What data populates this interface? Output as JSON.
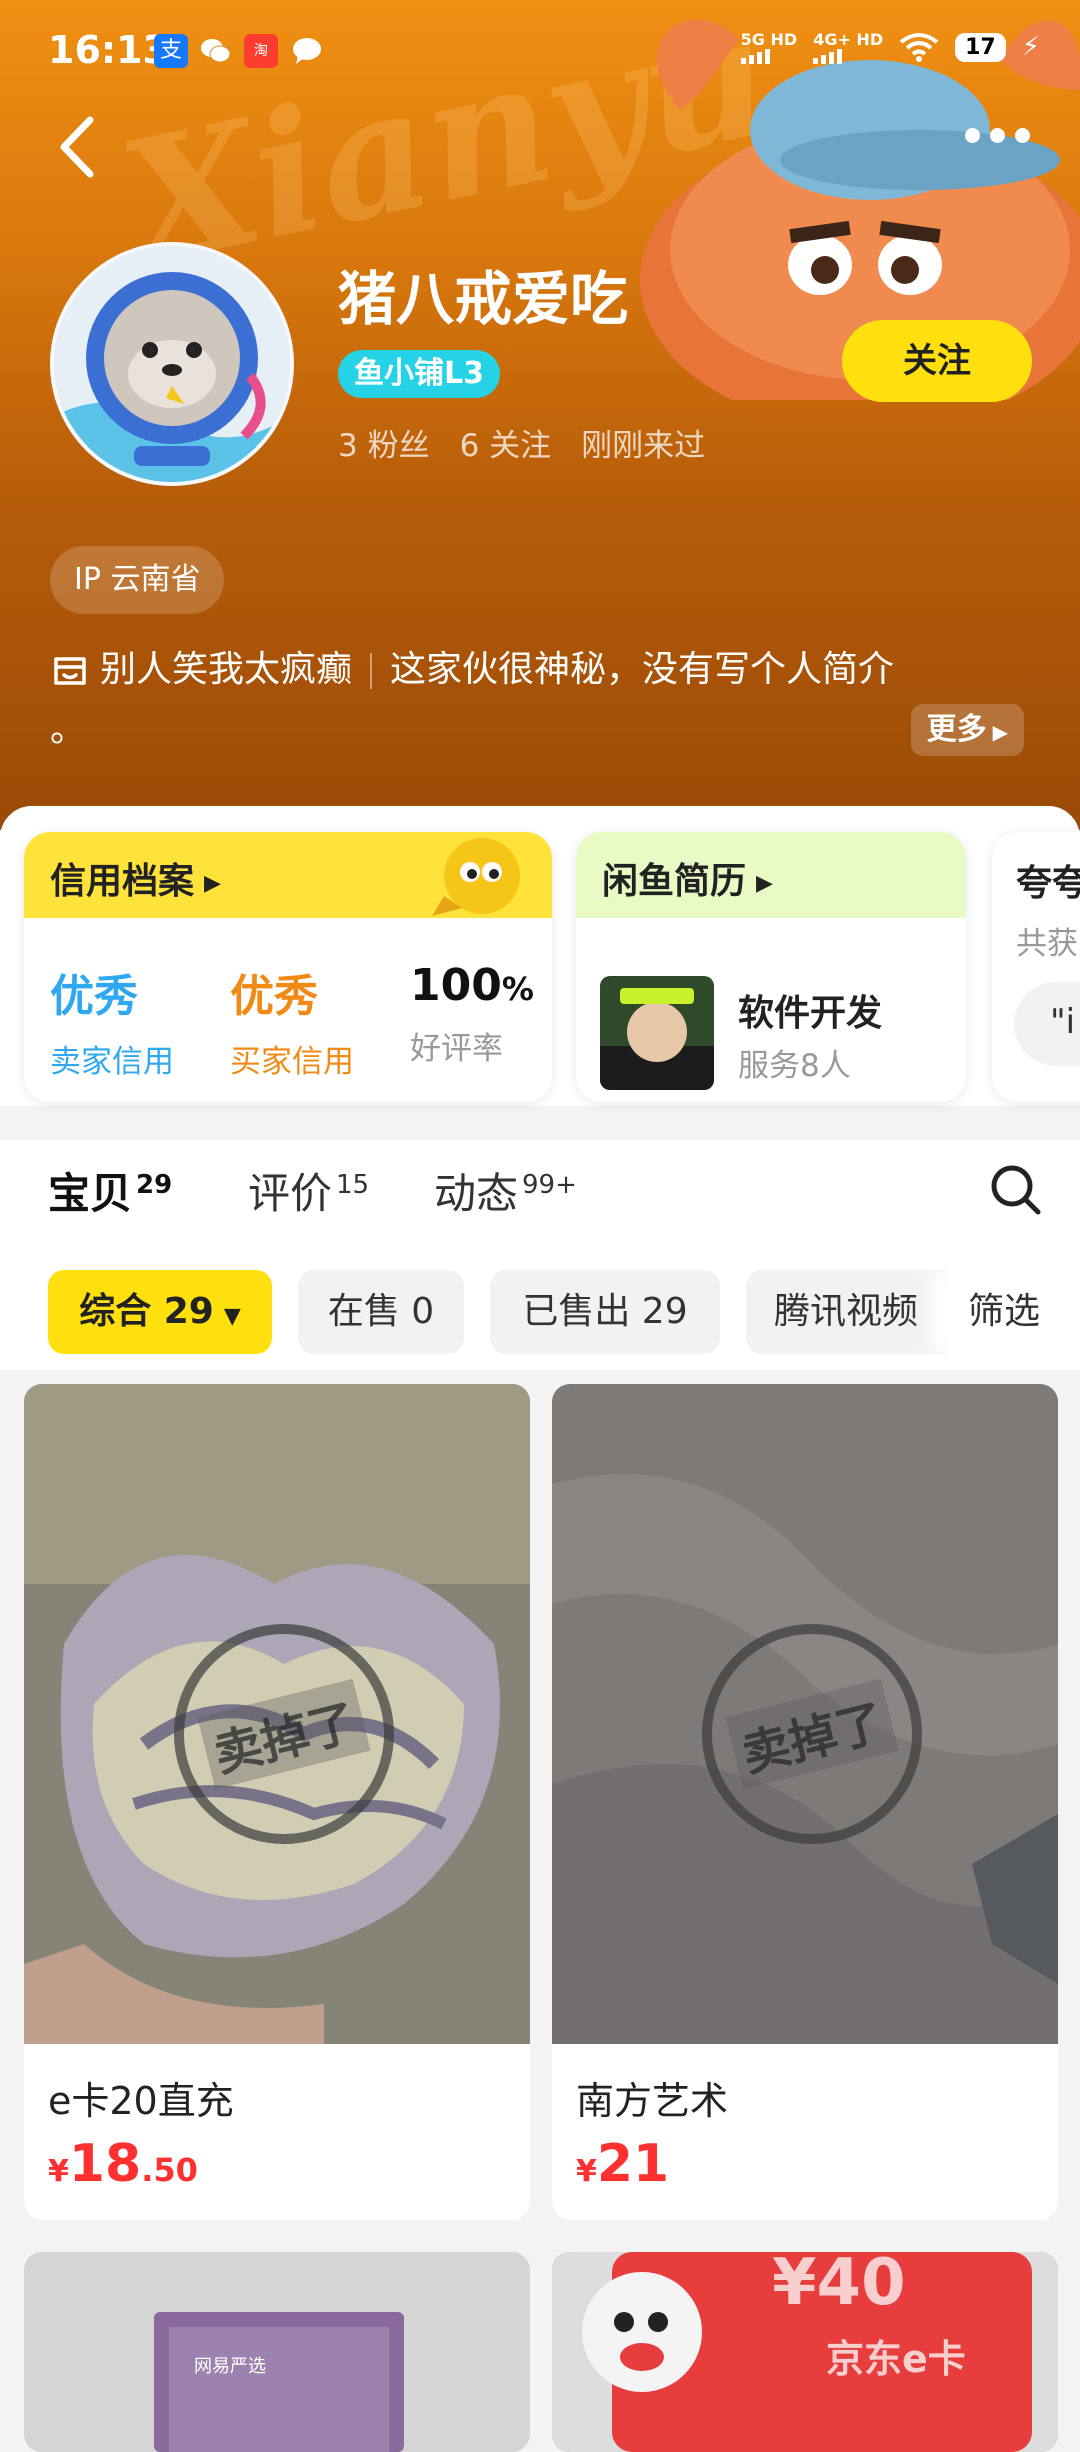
{
  "status_bar": {
    "time": "16:13",
    "network1": "5G HD",
    "network2": "4G+ HD",
    "battery": "17"
  },
  "profile": {
    "name": "猪八戒爱吃",
    "level_badge": "鱼小铺L3",
    "follow_label": "关注",
    "fans": "3 粉丝",
    "following": "6 关注",
    "last_seen": "刚刚来过",
    "ip": "IP 云南省",
    "bio_motto": "别人笑我太疯癫",
    "bio_text": "这家伙很神秘，没有写个人简介",
    "bio_tail": "。",
    "more_label": "更多"
  },
  "credit_card": {
    "title": "信用档案",
    "items": [
      {
        "value": "优秀",
        "label": "卖家信用",
        "color": "#2fa8f0"
      },
      {
        "value": "优秀",
        "label": "买家信用",
        "color": "#f08a14"
      },
      {
        "value": "100",
        "unit": "%",
        "label": "好评率",
        "color": "#111111"
      }
    ]
  },
  "resume_card": {
    "title": "闲鱼简历",
    "skill": "软件开发",
    "served": "服务8人"
  },
  "third_card": {
    "title": "夸夸",
    "sub": "共获",
    "quote": "\"i"
  },
  "tabs": [
    {
      "label": "宝贝",
      "count": "29"
    },
    {
      "label": "评价",
      "count": "15"
    },
    {
      "label": "动态",
      "count": "99+"
    }
  ],
  "filters": {
    "chips": [
      "综合 29",
      "在售 0",
      "已售出 29",
      "腾讯视频"
    ],
    "filter_label": "筛选"
  },
  "products": [
    {
      "name": "e卡20直充",
      "currency": "¥",
      "price_int": "18",
      "price_dec": ".50",
      "stamp": "卖掉了"
    },
    {
      "name": "南方艺术",
      "currency": "¥",
      "price_int": "21",
      "price_dec": "",
      "stamp": "卖掉了"
    }
  ],
  "bottom_products": {
    "brand": "网易严选",
    "card_price": "¥40",
    "card_label": "京东e卡"
  },
  "colors": {
    "accent_yellow": "#ffe00f",
    "price_red": "#ff3030",
    "badge_cyan": "#26d3e6"
  }
}
